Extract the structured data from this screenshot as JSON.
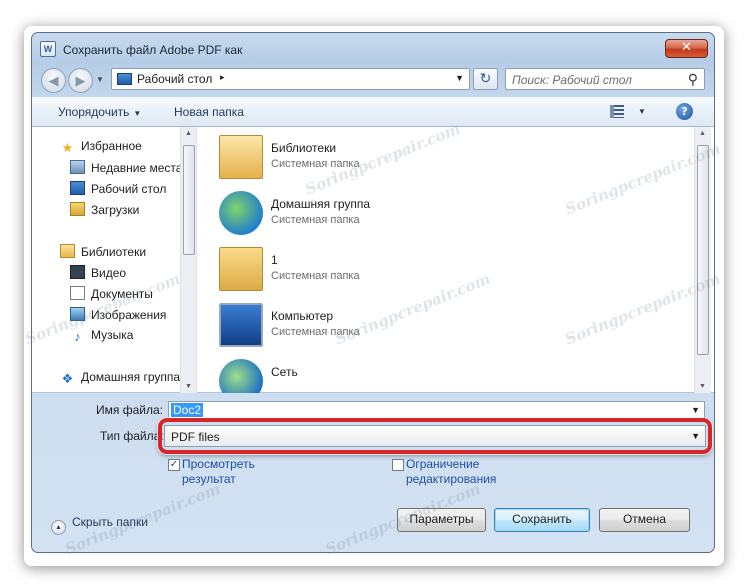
{
  "window": {
    "title": "Сохранить файл Adobe PDF как",
    "app_icon_letter": "W",
    "close_glyph": "✕"
  },
  "address_bar": {
    "back_glyph": "◀",
    "forward_glyph": "▶",
    "location": "Рабочий стол",
    "separator_glyph": "▸",
    "dropdown_glyph": "▼",
    "refresh_glyph": "↻",
    "search_placeholder": "Поиск: Рабочий стол",
    "search_glyph": "⚲"
  },
  "toolbar": {
    "organize_label": "Упорядочить",
    "organize_caret": "▼",
    "new_folder_label": "Новая папка",
    "view_caret": "▼",
    "help_glyph": "?"
  },
  "nav_pane": {
    "items": [
      {
        "label": "Избранное",
        "icon": "star-icon",
        "glyph": "★"
      },
      {
        "label": "Недавние места",
        "icon": "recent-places-icon"
      },
      {
        "label": "Рабочий стол",
        "icon": "desktop-icon"
      },
      {
        "label": "Загрузки",
        "icon": "downloads-icon"
      },
      {
        "label": "Библиотеки",
        "icon": "libraries-icon"
      },
      {
        "label": "Видео",
        "icon": "video-icon"
      },
      {
        "label": "Документы",
        "icon": "documents-icon"
      },
      {
        "label": "Изображения",
        "icon": "images-icon"
      },
      {
        "label": "Музыка",
        "icon": "music-icon",
        "glyph": "♪"
      },
      {
        "label": "Домашняя группа",
        "icon": "homegroup-icon",
        "glyph": "❖"
      }
    ]
  },
  "file_list": {
    "items": [
      {
        "name": "Библиотеки",
        "type": "Системная папка",
        "icon": "libraries-folder-icon"
      },
      {
        "name": "Домашняя группа",
        "type": "Системная папка",
        "icon": "homegroup-icon"
      },
      {
        "name": "1",
        "type": "Системная папка",
        "icon": "user-folder-icon"
      },
      {
        "name": "Компьютер",
        "type": "Системная папка",
        "icon": "computer-icon"
      },
      {
        "name": "Сеть",
        "type": "",
        "icon": "network-icon"
      }
    ]
  },
  "scroll_glyphs": {
    "up": "▲",
    "down": "▼"
  },
  "form": {
    "filename_label": "Имя файла:",
    "filename_value": "Doc2",
    "filetype_label": "Тип файла:",
    "filetype_value": "PDF files",
    "dropdown_glyph": "▼",
    "view_result_label_1": "Просмотреть",
    "view_result_label_2": "результат",
    "view_result_checked_glyph": "✓",
    "restrict_edit_label_1": "Ограничение",
    "restrict_edit_label_2": "редактирования"
  },
  "footer": {
    "hide_folders_label": "Скрыть папки",
    "hide_folders_glyph": "▲",
    "params_button": "Параметры",
    "save_button": "Сохранить",
    "cancel_button": "Отмена"
  },
  "watermark_text": "Soringpcrepair.com",
  "colors": {
    "highlight": "#d6262a",
    "selection": "#3399ff",
    "link_text": "#1e4fa0"
  }
}
